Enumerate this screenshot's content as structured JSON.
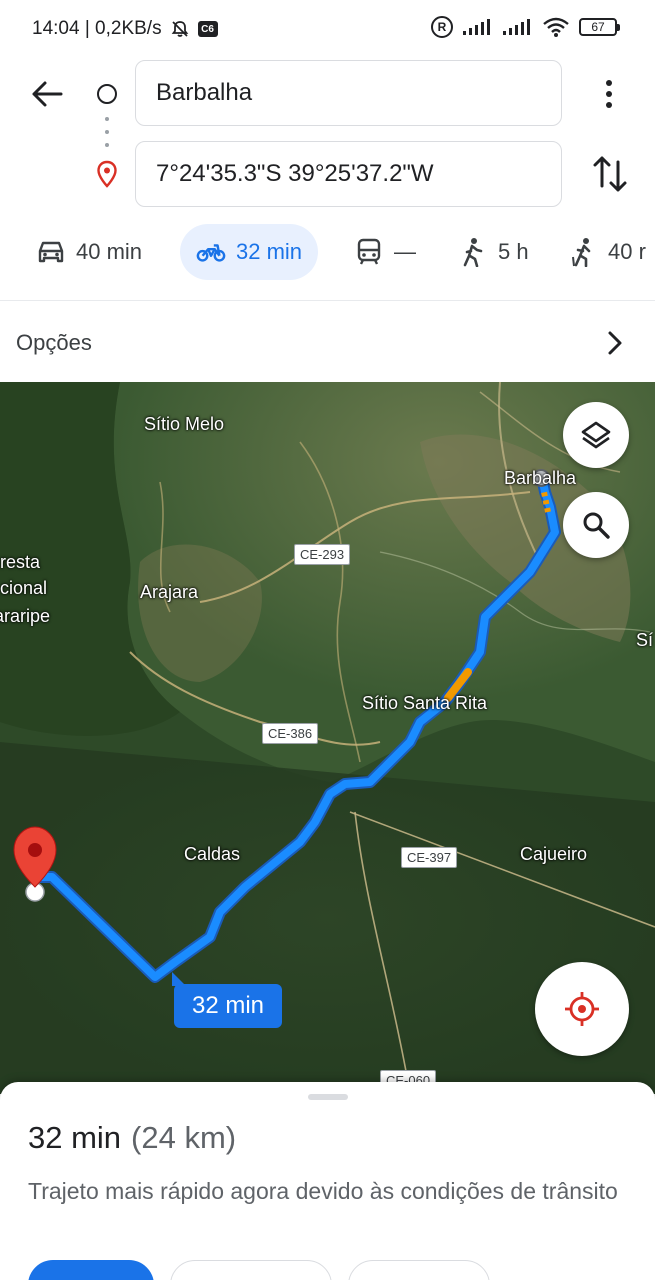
{
  "status_bar": {
    "time_speed": "14:04 | 0,2KB/s",
    "notification_icon": "bell-off-icon",
    "badge": "C6",
    "registered_icon": "R",
    "battery": "67"
  },
  "header": {
    "origin": "Barbalha",
    "destination": "7°24'35.3\"S 39°25'37.2\"W"
  },
  "modes": [
    {
      "icon": "car-icon",
      "label": "40 min"
    },
    {
      "icon": "motorcycle-icon",
      "label": "32 min",
      "active": true
    },
    {
      "icon": "transit-icon",
      "label": "—"
    },
    {
      "icon": "walk-icon",
      "label": "5 h"
    },
    {
      "icon": "ride-icon",
      "label": "40 r"
    }
  ],
  "options": {
    "label": "Opções"
  },
  "map": {
    "places": {
      "sitio_melo": "Sítio Melo",
      "barbalha": "Barbalha",
      "floresta_1": "resta",
      "floresta_2": "cional",
      "floresta_3": "araripe",
      "arajara": "Arajara",
      "sitio_santa_rita": "Sítio Santa Rita",
      "caldas": "Caldas",
      "cajueiro": "Cajueiro",
      "edge_right": "Sí"
    },
    "roads": {
      "ce293": "CE-293",
      "ce386": "CE-386",
      "ce397": "CE-397",
      "ce060": "CE-060"
    },
    "route_badge": "32 min",
    "colors": {
      "route": "#1a8cff",
      "traffic": "#f29900",
      "pin": "#ea4335"
    }
  },
  "sheet": {
    "duration": "32 min",
    "distance": "(24 km)",
    "reason": "Trajeto mais rápido agora devido às condições de trânsito"
  }
}
